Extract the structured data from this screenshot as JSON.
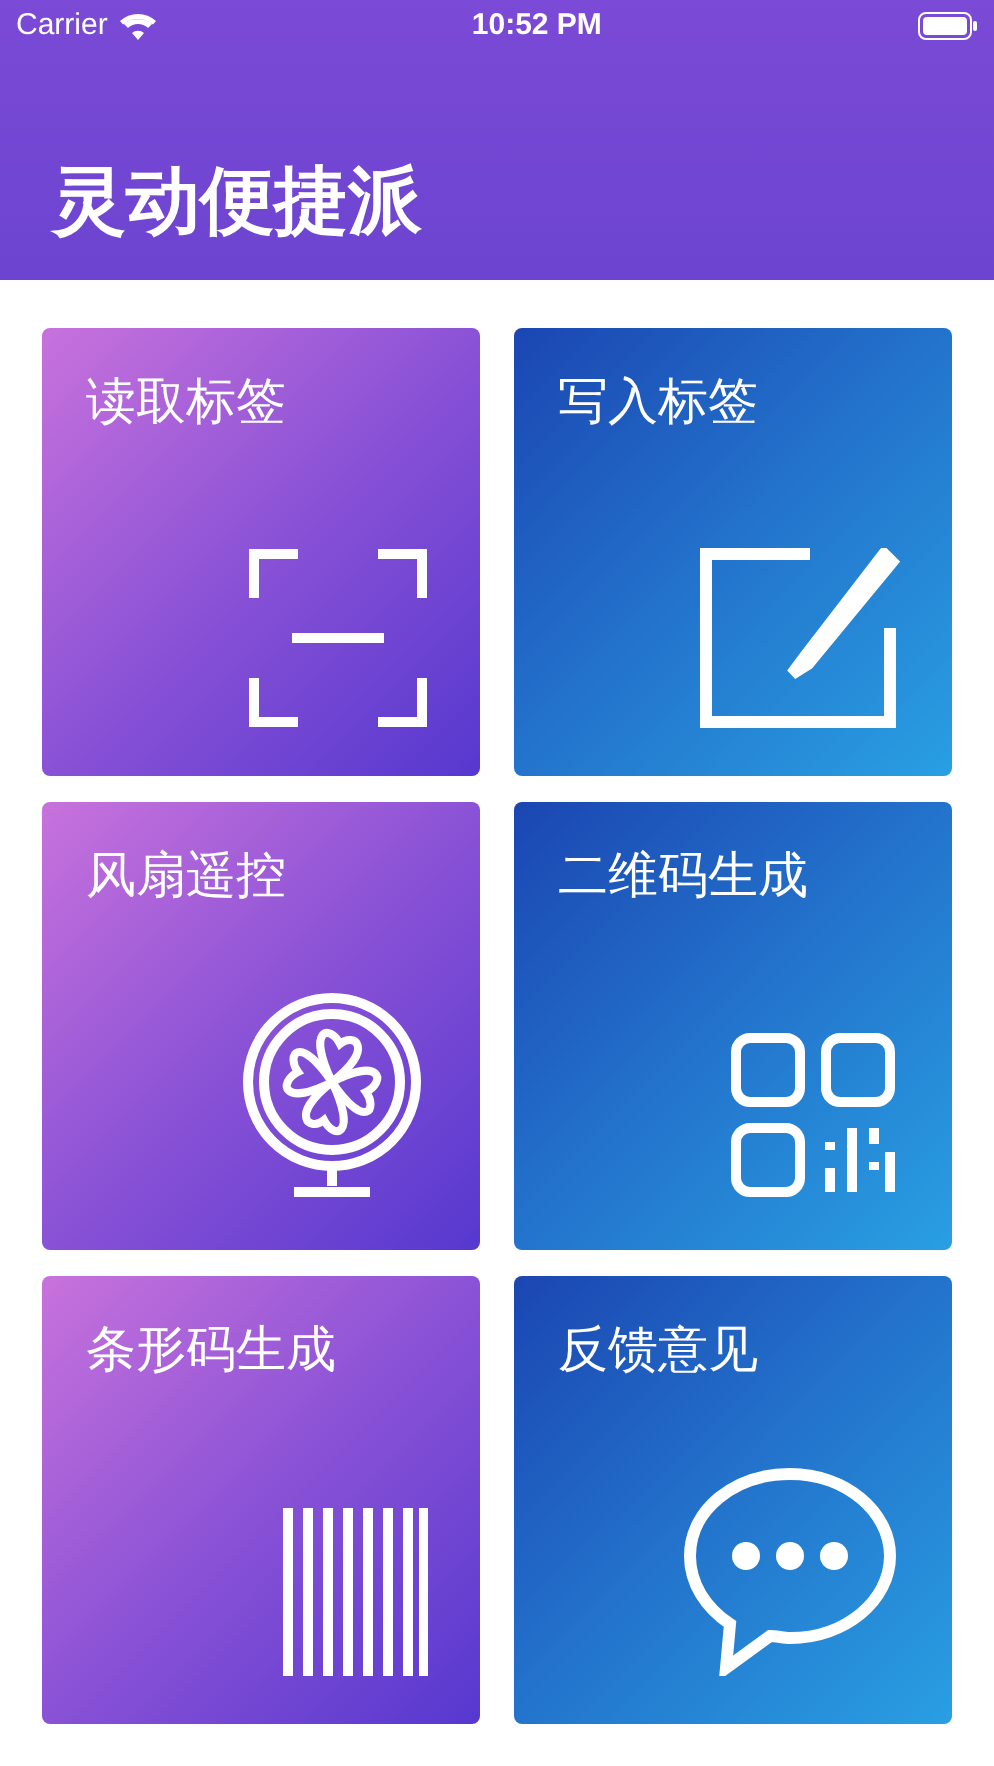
{
  "status_bar": {
    "carrier": "Carrier",
    "time": "10:52 PM"
  },
  "title": "灵动便捷派",
  "cards": [
    {
      "label": "读取标签",
      "kind": "scan"
    },
    {
      "label": "写入标签",
      "kind": "edit"
    },
    {
      "label": "风扇遥控",
      "kind": "fan"
    },
    {
      "label": "二维码生成",
      "kind": "qr"
    },
    {
      "label": "条形码生成",
      "kind": "barcode"
    },
    {
      "label": "反馈意见",
      "kind": "chat"
    }
  ]
}
